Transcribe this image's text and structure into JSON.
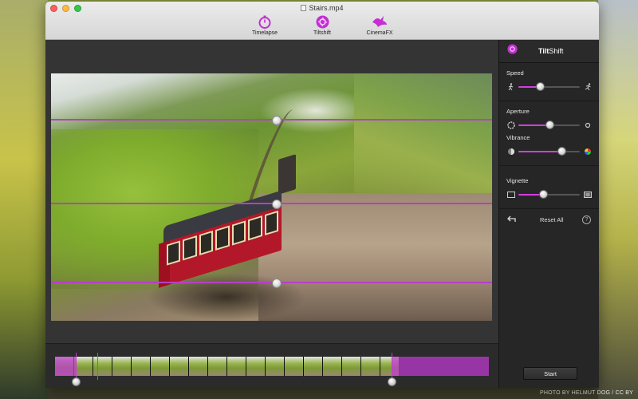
{
  "window": {
    "title": "Stairs.mp4"
  },
  "tabs": [
    {
      "label": "Timelapse",
      "icon": "timelapse-icon"
    },
    {
      "label": "Tiltshift",
      "icon": "tiltshift-icon"
    },
    {
      "label": "CinemaFX",
      "icon": "cinemafx-icon"
    }
  ],
  "colors": {
    "accent": "#c83bd6",
    "panel": "#262626"
  },
  "panel": {
    "title_bold": "Tilt",
    "title_rest": "Shift",
    "speed": {
      "label": "Speed",
      "value": 0.35
    },
    "aperture": {
      "label": "Aperture",
      "value": 0.5
    },
    "vibrance": {
      "label": "Vibrance",
      "value": 0.7
    },
    "vignette": {
      "label": "Vignette",
      "value": 0.4
    },
    "reset_label": "Reset All",
    "help_label": "?",
    "start_label": "Start"
  },
  "tilt_handles": 3,
  "timeline": {
    "frames": 18
  },
  "credit": "PHOTO BY HELMUT DOG / CC BY"
}
